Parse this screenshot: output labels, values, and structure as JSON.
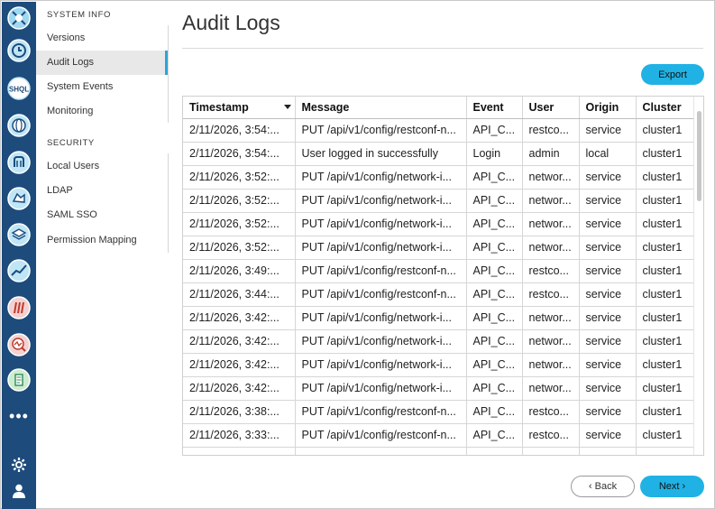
{
  "rail": {
    "icons": [
      "app-logo-icon",
      "clock-icon",
      "shql-icon",
      "globe-icon",
      "network-icon",
      "map-icon",
      "layers-icon",
      "chart-icon",
      "rack-icon",
      "search-chart-icon",
      "document-icon",
      "more-icon",
      "gear-icon",
      "user-icon"
    ],
    "logo_text": "SHQL",
    "more": "•••"
  },
  "sidebar": {
    "section1": "SYSTEM INFO",
    "section1_items": [
      {
        "label": "Versions"
      },
      {
        "label": "Audit Logs",
        "active": true
      },
      {
        "label": "System Events"
      },
      {
        "label": "Monitoring"
      }
    ],
    "section2": "SECURITY",
    "section2_items": [
      {
        "label": "Local Users"
      },
      {
        "label": "LDAP"
      },
      {
        "label": "SAML SSO"
      },
      {
        "label": "Permission Mapping"
      }
    ]
  },
  "main": {
    "title": "Audit Logs",
    "export_label": "Export",
    "back_label": "Back",
    "next_label": "Next"
  },
  "table": {
    "headers": [
      "Timestamp",
      "Message",
      "Event",
      "User",
      "Origin",
      "Cluster"
    ],
    "rows": [
      [
        "2/11/2026, 3:54:...",
        "PUT /api/v1/config/restconf-n...",
        "API_C...",
        "restco...",
        "service",
        "cluster1"
      ],
      [
        "2/11/2026, 3:54:...",
        "User logged in successfully",
        "Login",
        "admin",
        "local",
        "cluster1"
      ],
      [
        "2/11/2026, 3:52:...",
        "PUT /api/v1/config/network-i...",
        "API_C...",
        "networ...",
        "service",
        "cluster1"
      ],
      [
        "2/11/2026, 3:52:...",
        "PUT /api/v1/config/network-i...",
        "API_C...",
        "networ...",
        "service",
        "cluster1"
      ],
      [
        "2/11/2026, 3:52:...",
        "PUT /api/v1/config/network-i...",
        "API_C...",
        "networ...",
        "service",
        "cluster1"
      ],
      [
        "2/11/2026, 3:52:...",
        "PUT /api/v1/config/network-i...",
        "API_C...",
        "networ...",
        "service",
        "cluster1"
      ],
      [
        "2/11/2026, 3:49:...",
        "PUT /api/v1/config/restconf-n...",
        "API_C...",
        "restco...",
        "service",
        "cluster1"
      ],
      [
        "2/11/2026, 3:44:...",
        "PUT /api/v1/config/restconf-n...",
        "API_C...",
        "restco...",
        "service",
        "cluster1"
      ],
      [
        "2/11/2026, 3:42:...",
        "PUT /api/v1/config/network-i...",
        "API_C...",
        "networ...",
        "service",
        "cluster1"
      ],
      [
        "2/11/2026, 3:42:...",
        "PUT /api/v1/config/network-i...",
        "API_C...",
        "networ...",
        "service",
        "cluster1"
      ],
      [
        "2/11/2026, 3:42:...",
        "PUT /api/v1/config/network-i...",
        "API_C...",
        "networ...",
        "service",
        "cluster1"
      ],
      [
        "2/11/2026, 3:42:...",
        "PUT /api/v1/config/network-i...",
        "API_C...",
        "networ...",
        "service",
        "cluster1"
      ],
      [
        "2/11/2026, 3:38:...",
        "PUT /api/v1/config/restconf-n...",
        "API_C...",
        "restco...",
        "service",
        "cluster1"
      ],
      [
        "2/11/2026, 3:33:...",
        "PUT /api/v1/config/restconf-n...",
        "API_C...",
        "restco...",
        "service",
        "cluster1"
      ]
    ]
  },
  "colors": {
    "rail": "#1d4b7c",
    "accent": "#20b2e4",
    "active_indicator": "#2aa7d6"
  }
}
